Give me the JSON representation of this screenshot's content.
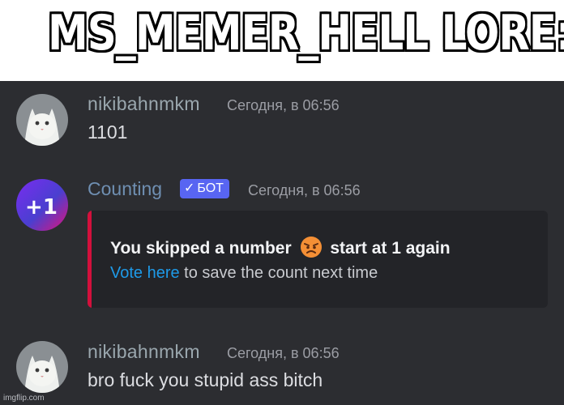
{
  "caption": {
    "text": "MS_MEMER_HELL LORE:"
  },
  "messages": [
    {
      "username": "nikibahnmkm",
      "timestamp": "Сегодня, в 06:56",
      "text": "1101"
    },
    {
      "username": "Counting",
      "badge": "БОТ",
      "timestamp": "Сегодня, в 06:56",
      "avatar_text": "+1",
      "embed": {
        "title_start": "You skipped a number",
        "emoji": "angry-face",
        "title_end": "start at 1 again",
        "link_text": "Vote here",
        "desc_rest": " to save the count next time",
        "accent_color": "#d3103c"
      }
    },
    {
      "username": "nikibahnmkm",
      "timestamp": "Сегодня, в 06:56",
      "text": "bro fuck you stupid ass bitch"
    }
  ],
  "watermark": "imgflip.com"
}
